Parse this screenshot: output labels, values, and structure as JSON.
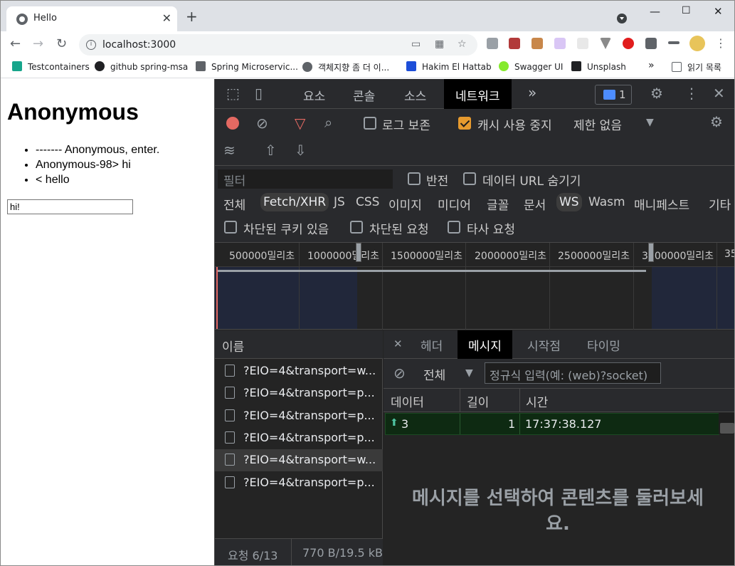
{
  "browser": {
    "tab_title": "Hello",
    "tab_close": "✕",
    "new_tab": "+",
    "url": "localhost:3000",
    "window_controls": {
      "minimize": "—",
      "maximize": "☐",
      "close": "✕"
    }
  },
  "bookmarks": [
    {
      "label": "Testcontainers",
      "icon": "testcontainers-icon",
      "color": "#17a58b"
    },
    {
      "label": "github spring-msa",
      "icon": "github-icon",
      "color": "#202124"
    },
    {
      "label": "Spring Microservic...",
      "icon": "page-icon",
      "color": "#5f6368"
    },
    {
      "label": "객체지향 좀 더 이...",
      "icon": "globe-icon",
      "color": "#5f6368"
    },
    {
      "label": "Hakim El Hattab",
      "icon": "h-icon",
      "color": "#1d4ed8"
    },
    {
      "label": "Swagger UI",
      "icon": "swagger-icon",
      "color": "#85ea2d"
    },
    {
      "label": "Unsplash",
      "icon": "unsplash-icon",
      "color": "#202124"
    }
  ],
  "bookmarks_more": "»",
  "reading_list": "읽기 목록",
  "page": {
    "heading": "Anonymous",
    "messages": [
      "------- Anonymous, enter.",
      "Anonymous-98> hi",
      "< hello"
    ],
    "input_value": "hi!"
  },
  "devtools": {
    "tabs": [
      "요소",
      "콘솔",
      "소스",
      "네트워크"
    ],
    "active_tab": "네트워크",
    "more_tabs": "»",
    "issues_count": "1",
    "toolbar": {
      "preserve_log": "로그 보존",
      "disable_cache": "캐시 사용 중지",
      "throttling": "제한 없음"
    },
    "filter_placeholder": "필터",
    "invert": "반전",
    "hide_data_urls": "데이터 URL 숨기기",
    "type_filters": [
      "전체",
      "Fetch/XHR",
      "JS",
      "CSS",
      "이미지",
      "미디어",
      "글꼴",
      "문서",
      "WS",
      "Wasm",
      "매니페스트",
      "기타"
    ],
    "blocked_cookies": "차단된 쿠키 있음",
    "blocked_requests": "차단된 요청",
    "third_party": "타사 요청",
    "timeline_ticks": [
      "500000밀리초",
      "1000000밀리초",
      "1500000밀리초",
      "2000000밀리초",
      "2500000밀리초",
      "3000000밀리초",
      "35"
    ],
    "name_header": "이름",
    "requests": [
      "?EIO=4&transport=w...",
      "?EIO=4&transport=p...",
      "?EIO=4&transport=p...",
      "?EIO=4&transport=p...",
      "?EIO=4&transport=w...",
      "?EIO=4&transport=p..."
    ],
    "footer_requests": "요청 6/13",
    "footer_size": "770 B/19.5 kB",
    "detail_tabs": [
      "헤더",
      "메시지",
      "시작점",
      "타이밍"
    ],
    "detail_close": "✕",
    "message_filter": "전체",
    "regex_placeholder": "정규식 입력(예: (web)?socket)",
    "columns": [
      "데이터",
      "길이",
      "시간"
    ],
    "message": {
      "data": "3",
      "length": "1",
      "time": "17:37:38.127"
    },
    "empty_text": "메시지를 선택하여 콘텐츠를 둘러보세요."
  }
}
